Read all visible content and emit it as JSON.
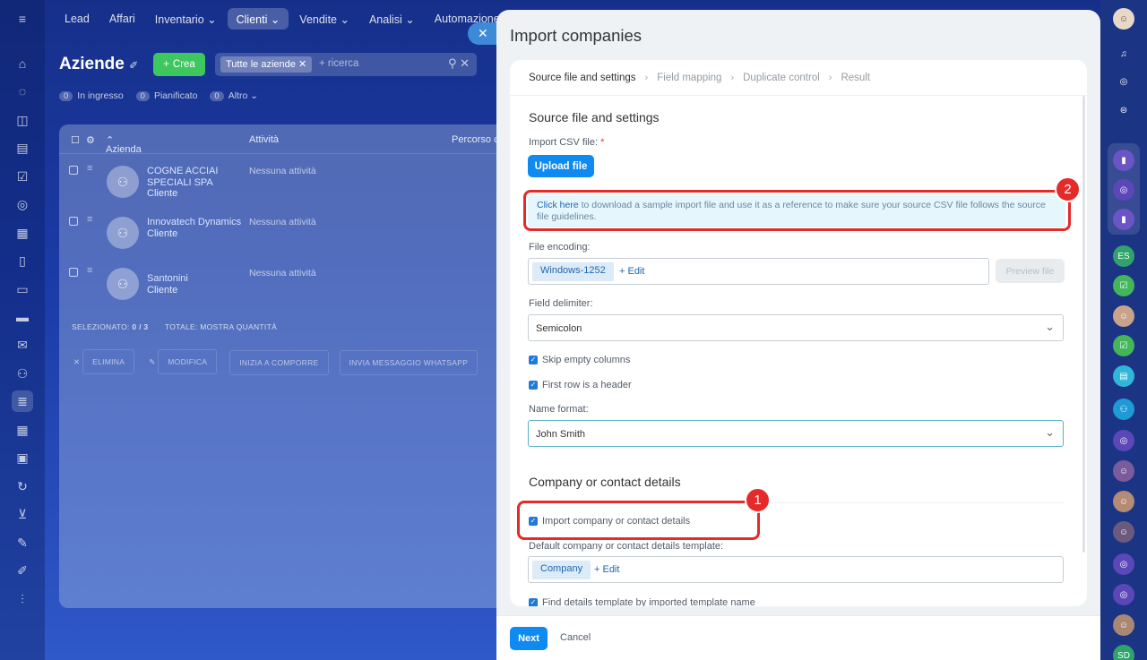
{
  "top_nav": [
    "Lead",
    "Affari",
    "Inventario ⌄",
    "Clienti ⌄",
    "Vendite ⌄",
    "Analisi ⌄",
    "Automazione Se"
  ],
  "crm": {
    "title": "Aziende",
    "create_label": "Crea",
    "filter_chip": "Tutte le aziende",
    "search_placeholder": "+ ricerca",
    "counters": [
      {
        "n": "0",
        "label": "In ingresso"
      },
      {
        "n": "0",
        "label": "Pianificato"
      },
      {
        "n": "0",
        "label": "Altro"
      }
    ],
    "columns": [
      "Azienda",
      "Attività",
      "Percorso c"
    ],
    "rows": [
      {
        "name": "COGNE ACCIAI SPECIALI SPA",
        "type": "Cliente",
        "activity": "Nessuna attività"
      },
      {
        "name": "Innovatech Dynamics",
        "type": "Cliente",
        "activity": "Nessuna attività"
      },
      {
        "name": "Santonini",
        "type": "Cliente",
        "activity": "Nessuna attività"
      }
    ],
    "selected_label": "SELEZIONATO:",
    "selected_value": "0 / 3",
    "total_label": "TOTALE: MOSTRA QUANTITÀ",
    "actions": [
      "ELIMINA",
      "MODIFICA",
      "INIZIA A COMPORRE",
      "INVIA MESSAGGIO WHATSAPP"
    ]
  },
  "slider": {
    "title": "Import companies",
    "steps": [
      "Source file and settings",
      "Field mapping",
      "Duplicate control",
      "Result"
    ],
    "section1_title": "Source file and settings",
    "import_csv_label": "Import CSV file:",
    "required_mark": "*",
    "upload_label": "Upload file",
    "note_link": "Click here",
    "note_text": " to download a sample import file and use it as a reference to make sure your source CSV file follows the source file guidelines.",
    "encoding_label": "File encoding:",
    "encoding_value": "Windows-1252",
    "edit_label": "+ Edit",
    "preview_label": "Preview file",
    "delimiter_label": "Field delimiter:",
    "delimiter_value": "Semicolon",
    "skip_empty_label": "Skip empty columns",
    "first_row_label": "First row is a header",
    "name_format_label": "Name format:",
    "name_format_value": "John Smith",
    "section2_title": "Company or contact details",
    "import_details_label": "Import company or contact details",
    "template_label": "Default company or contact details template:",
    "template_value": "Company",
    "find_template_label": "Find details template by imported template name",
    "next_label": "Next",
    "cancel_label": "Cancel",
    "badge_1": "1",
    "badge_2": "2"
  },
  "right_rail": {
    "initials_1": "ES",
    "initials_2": "SD"
  },
  "colors": {
    "accent_blue": "#0e8af0",
    "highlight_red": "#e52a2a",
    "create_green": "#3ec75f",
    "note_bg": "#e5f6fd"
  }
}
